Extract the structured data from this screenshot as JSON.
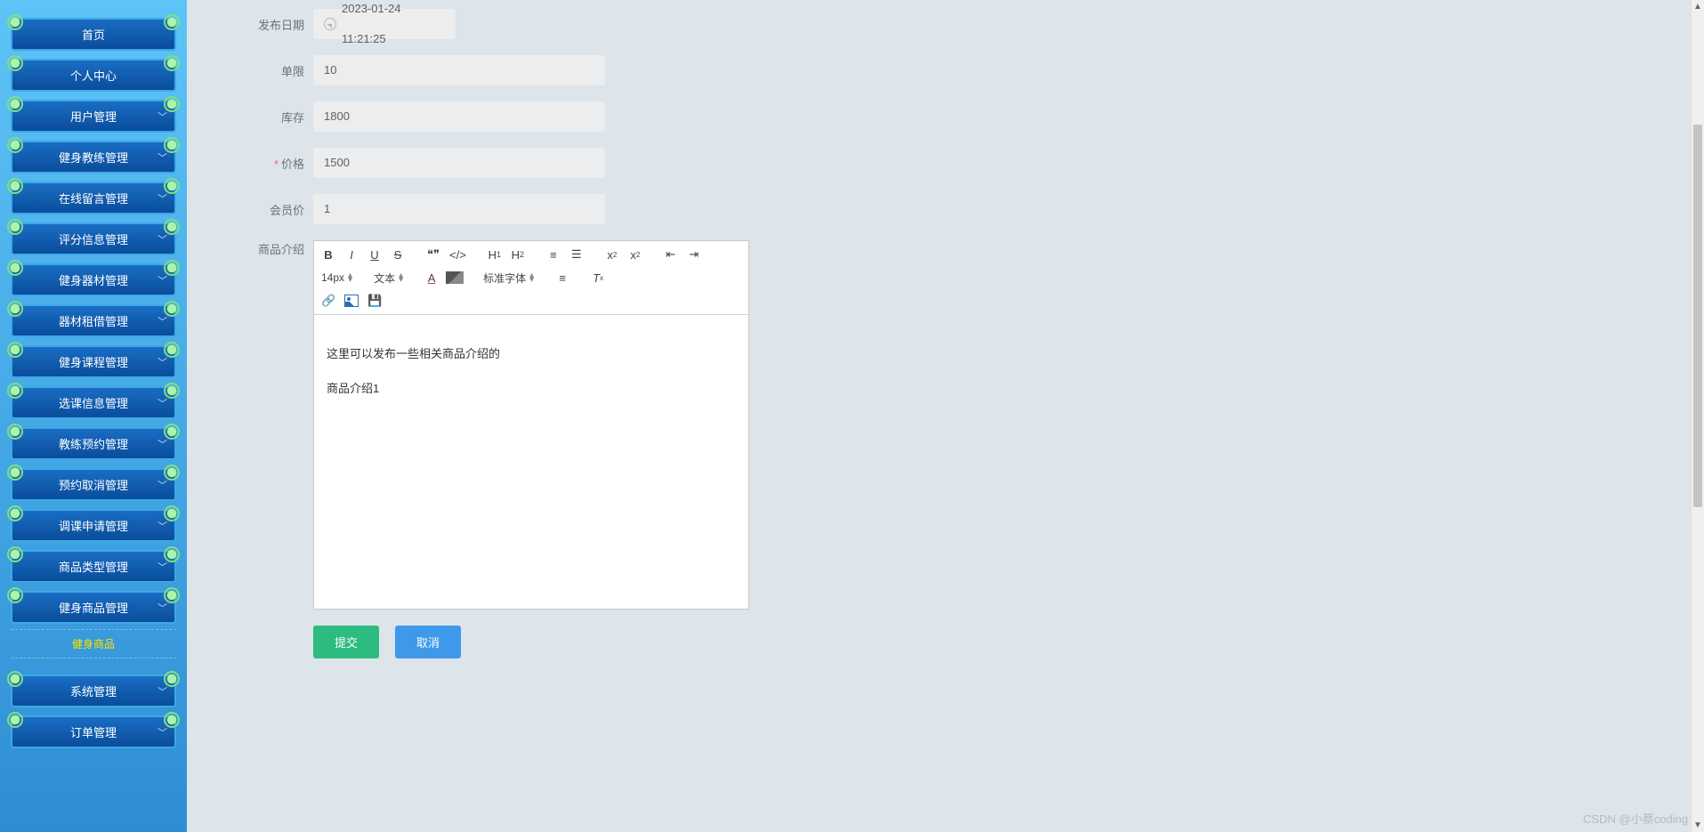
{
  "sidebar": {
    "items": [
      {
        "label": "首页",
        "expandable": false
      },
      {
        "label": "个人中心",
        "expandable": false
      },
      {
        "label": "用户管理",
        "expandable": true
      },
      {
        "label": "健身教练管理",
        "expandable": true
      },
      {
        "label": "在线留言管理",
        "expandable": true
      },
      {
        "label": "评分信息管理",
        "expandable": true
      },
      {
        "label": "健身器材管理",
        "expandable": true
      },
      {
        "label": "器材租借管理",
        "expandable": true
      },
      {
        "label": "健身课程管理",
        "expandable": true
      },
      {
        "label": "选课信息管理",
        "expandable": true
      },
      {
        "label": "教练预约管理",
        "expandable": true
      },
      {
        "label": "预约取消管理",
        "expandable": true
      },
      {
        "label": "调课申请管理",
        "expandable": true
      },
      {
        "label": "商品类型管理",
        "expandable": true
      },
      {
        "label": "健身商品管理",
        "expandable": true
      }
    ],
    "active_sub": "健身商品",
    "bottom": [
      {
        "label": "系统管理",
        "expandable": true
      },
      {
        "label": "订单管理",
        "expandable": true
      }
    ]
  },
  "form": {
    "publish_date": {
      "label": "发布日期",
      "value": "2023-01-24 11:21:25"
    },
    "single_limit": {
      "label": "单限",
      "value": "10"
    },
    "stock": {
      "label": "库存",
      "value": "1800"
    },
    "price": {
      "label": "价格",
      "value": "1500",
      "required": true
    },
    "member_price": {
      "label": "会员价",
      "value": "1"
    },
    "desc": {
      "label": "商品介绍"
    }
  },
  "editor": {
    "font_size": "14px",
    "font_style": "文本",
    "font_family": "标准字体",
    "content_line1": "这里可以发布一些相关商品介绍的",
    "content_line2": "商品介绍1"
  },
  "buttons": {
    "submit": "提交",
    "cancel": "取消"
  },
  "watermark": "CSDN @小蔡coding"
}
